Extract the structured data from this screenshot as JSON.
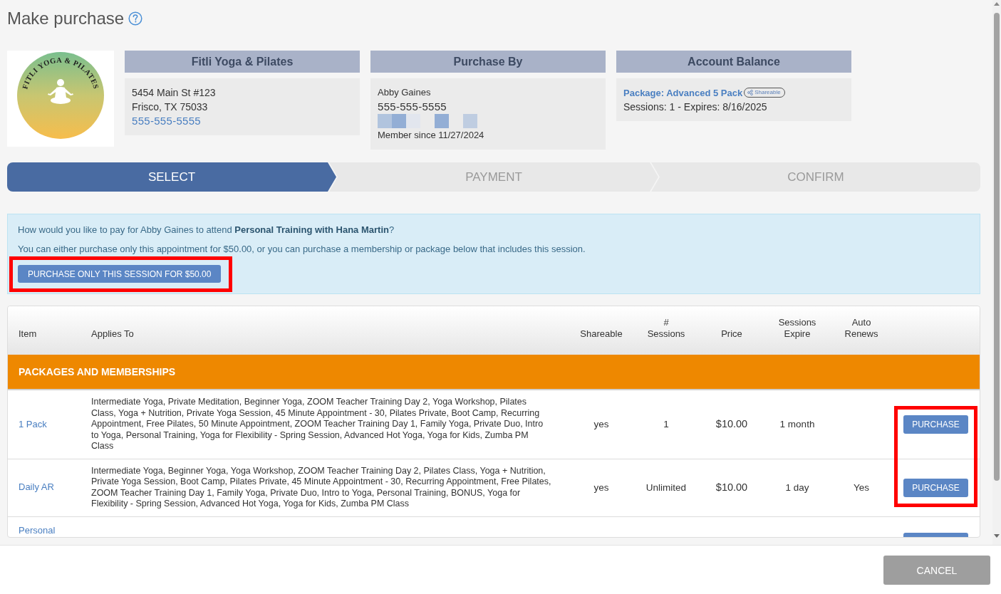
{
  "page": {
    "title": "Make purchase"
  },
  "logo": {
    "text": "FITLI YOGA & PILATES"
  },
  "cards": [
    {
      "heading": "Fitli Yoga & Pilates",
      "lines": [
        {
          "kind": "text",
          "text": "5454 Main St #123"
        },
        {
          "kind": "text",
          "text": "Frisco, TX 75033"
        },
        {
          "kind": "link",
          "text": "555-555-5555"
        }
      ]
    },
    {
      "heading": "Purchase By",
      "lines": [
        {
          "kind": "small",
          "text": "Abby Gaines"
        },
        {
          "kind": "large",
          "text": "555-555-5555"
        },
        {
          "kind": "redacted"
        },
        {
          "kind": "small",
          "text": "Member since 11/27/2024"
        }
      ]
    },
    {
      "heading": "Account Balance",
      "lines": [
        {
          "kind": "package",
          "text": "Package: Advanced 5 Pack",
          "badge": "Shareable"
        },
        {
          "kind": "text",
          "text": "Sessions: 1 - Expires: 8/16/2025"
        }
      ]
    }
  ],
  "steps": [
    {
      "label": "SELECT",
      "selected": true
    },
    {
      "label": "PAYMENT",
      "selected": false
    },
    {
      "label": "CONFIRM",
      "selected": false
    }
  ],
  "notice": {
    "question": "How would you like to pay for Abby Gaines to attend **Personal Training with Hana Martin**?",
    "text": "You can either purchase only this appointment for $50.00, or you can purchase a membership or package below that includes this session.",
    "button": {
      "label": "PURCHASE ONLY THIS SESSION FOR $50.00",
      "highlighted": true
    }
  },
  "table": {
    "columns": [
      {
        "label": "Item"
      },
      {
        "label": "Applies To"
      },
      {
        "label": "Shareable"
      },
      {
        "label": "# Sessions"
      },
      {
        "label": "Price"
      },
      {
        "label": "Sessions Expire"
      },
      {
        "label": "Auto Renews"
      }
    ],
    "section_label": "PACKAGES AND MEMBERSHIPS",
    "rows": [
      {
        "kind": "full",
        "item": "1 Pack",
        "applies_to": "Intermediate Yoga, Private Meditation, Beginner Yoga, ZOOM Teacher Training Day 2, Yoga Workshop, Pilates Class, Yoga + Nutrition, Private Yoga Session, 45 Minute Appointment - 30, Pilates Private, Boot Camp, Recurring Appointment, Free Pilates, 50 Minute Appointment, ZOOM Teacher Training Day 1, Family Yoga, Private Duo, Intro to Yoga, Personal Training, Yoga for Flexibility - Spring Session, Advanced Hot Yoga, Yoga for Kids, Zumba PM Class",
        "shareable": "yes",
        "sessions": "1",
        "price": "$10.00",
        "expires": "1 month",
        "action": {
          "kind": "button",
          "label": "PURCHASE"
        },
        "highlighted": true
      },
      {
        "kind": "full",
        "item": "Daily AR",
        "applies_to": "Intermediate Yoga, Beginner Yoga, Yoga Workshop, ZOOM Teacher Training Day 2, Pilates Class, Yoga + Nutrition, Private Yoga Session, Boot Camp, Pilates Private, 45 Minute Appointment - 30, Recurring Appointment, Free Pilates, ZOOM Teacher Training Day 1, Family Yoga, Private Duo, Intro to Yoga, Personal Training, BONUS, Yoga for Flexibility - Spring Session, Advanced Hot Yoga, Yoga for Kids, Zumba PM Class",
        "shareable": "yes",
        "sessions": "Unlimited",
        "price": "$10.00",
        "expires": "1 day",
        "auto_renews": "Yes",
        "action": {
          "kind": "button",
          "label": "PURCHASE"
        },
        "highlighted": true
      },
      {
        "kind": "cut",
        "item": "Personal",
        "action": {
          "kind": "button"
        },
        "highlighted": false
      }
    ]
  },
  "footer": {
    "buttons": [
      {
        "label": "CANCEL"
      }
    ]
  }
}
